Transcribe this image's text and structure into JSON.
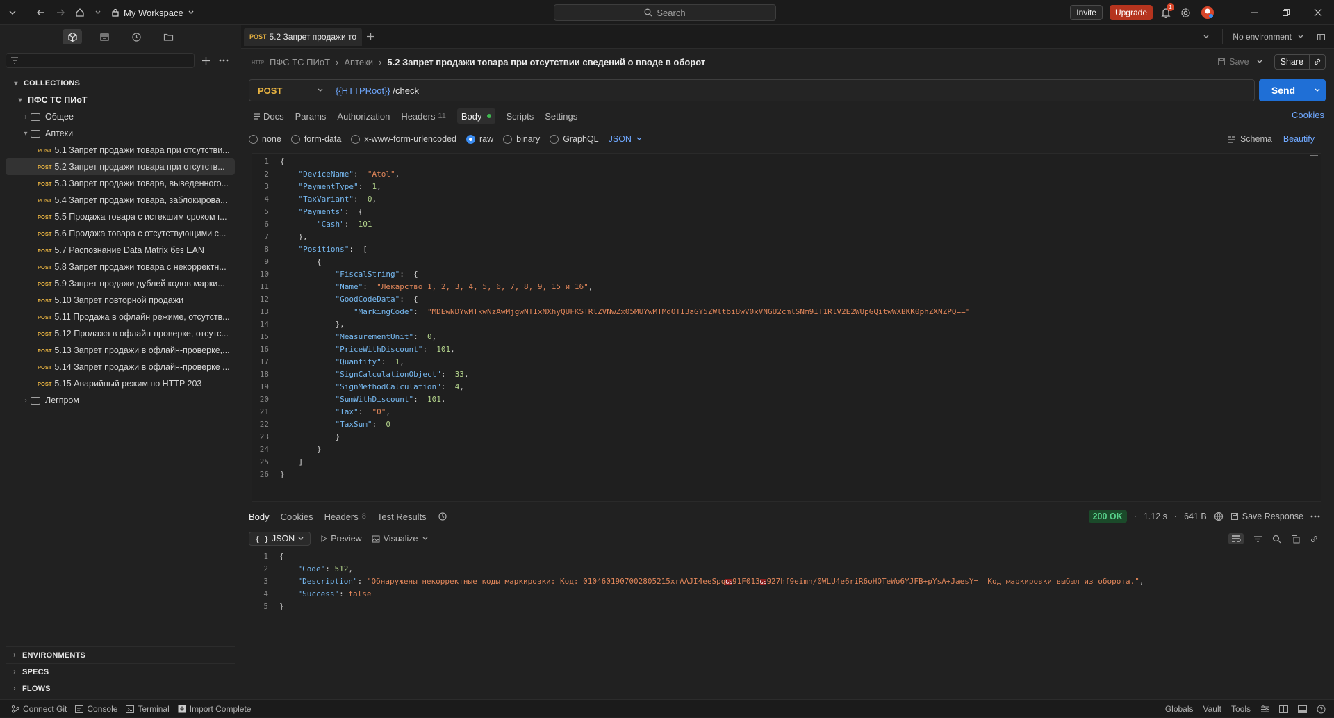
{
  "window": {
    "workspace": "My Workspace",
    "search_placeholder": "Search",
    "invite": "Invite",
    "upgrade": "Upgrade",
    "notification_count": "1"
  },
  "sidebar": {
    "sections": {
      "collections": "COLLECTIONS",
      "environments": "ENVIRONMENTS",
      "specs": "SPECS",
      "flows": "FLOWS"
    },
    "collection_name": "ПФС ТС ПИоТ",
    "folders": {
      "general": "Общее",
      "pharmacies": "Аптеки",
      "light_industry": "Легпром"
    },
    "method_tag": "POST",
    "requests": [
      "5.1 Запрет продажи товара при отсутстви...",
      "5.2 Запрет продажи товара при отсутств...",
      "5.3 Запрет продажи товара, выведенного...",
      "5.4 Запрет продажи товара, заблокирова...",
      "5.5 Продажа товара с истекшим сроком г...",
      "5.6 Продажа товара с отсутствующими с...",
      "5.7 Распознание Data Matrix без EAN",
      "5.8 Запрет продажи товара с некорректн...",
      "5.9 Запрет продажи дублей кодов марки...",
      "5.10 Запрет повторной продажи",
      "5.11 Продажа в офлайн режиме, отсутств...",
      "5.12 Продажа в офлайн-проверке, отсутс...",
      "5.13 Запрет продажи в офлайн-проверке,...",
      "5.14 Запрет продажи в офлайн-проверке ...",
      "5.15 Аварийный режим по HTTP 203"
    ]
  },
  "tab": {
    "method": "POST",
    "title": "5.2 Запрет продажи то"
  },
  "environment": "No environment",
  "breadcrumb": {
    "collection": "ПФС ТС ПИоТ",
    "folder": "Аптеки",
    "current": "5.2 Запрет продажи товара при отсутствии сведений о вводе в оборот"
  },
  "actions": {
    "save": "Save",
    "share": "Share"
  },
  "request": {
    "method": "POST",
    "url_var": "{{HTTPRoot}}",
    "url_path": " /check",
    "send": "Send"
  },
  "request_tabs": {
    "docs": "Docs",
    "params": "Params",
    "authorization": "Authorization",
    "headers": "Headers",
    "headers_count": "11",
    "body": "Body",
    "scripts": "Scripts",
    "settings": "Settings",
    "cookies": "Cookies"
  },
  "body_types": {
    "none": "none",
    "form_data": "form-data",
    "urlencoded": "x-www-form-urlencoded",
    "raw": "raw",
    "binary": "binary",
    "graphql": "GraphQL",
    "format": "JSON",
    "schema": "Schema",
    "beautify": "Beautify"
  },
  "request_body": {
    "DeviceName": "\"Atol\"",
    "PaymentType": "1",
    "TaxVariant": "0",
    "Cash": "101",
    "FiscalString": "",
    "Name": "\"Лекарство 1, 2, 3, 4, 5, 6, 7, 8, 9, 15 и 16\"",
    "MarkingCode": "\"MDEwNDYwMTkwNzAwMjgwNTIxNXhyQUFKSTRlZVNwZx05MUYwMTMdOTI3aGY5ZWltbi8wV0xVNGU2cmlSNm9IT1RlV2E2WUpGQitwWXBKK0phZXNZPQ==\"",
    "MeasurementUnit": "0",
    "PriceWithDiscount": "101",
    "Quantity": "1",
    "SignCalculationObject": "33",
    "SignMethodCalculation": "4",
    "SumWithDiscount": "101",
    "Tax": "\"0\"",
    "TaxSum": "0"
  },
  "response_tabs": {
    "body": "Body",
    "cookies": "Cookies",
    "headers": "Headers",
    "headers_count": "8",
    "test_results": "Test Results"
  },
  "response_meta": {
    "status": "200 OK",
    "time": "1.12 s",
    "size": "641 B",
    "save_response": "Save Response"
  },
  "response_tools": {
    "format": "JSON",
    "preview": "Preview",
    "visualize": "Visualize"
  },
  "response_body": {
    "code": "512",
    "description_prefix": "\"Обнаружены некорректные коды маркировки: Код: 0104601907002805215xrAAJI4eeSpg",
    "gs": "GS",
    "description_mid": "91F013",
    "description_link": "927hf9eimn/0WLU4e6riR6oHOTeWo6YJFB+pYsA+JaesY=",
    "description_suffix": "  Код маркировки выбыл из оборота.\"",
    "success": "false"
  },
  "statusbar": {
    "connect_git": "Connect Git",
    "console": "Console",
    "terminal": "Terminal",
    "import": "Import Complete",
    "globals": "Globals",
    "vault": "Vault",
    "tools": "Tools"
  },
  "colors": {
    "accent": "#1f6fd6",
    "post": "#e8b341",
    "upgrade": "#b5341e",
    "json_key": "#76b8f0",
    "json_string": "#e0865a",
    "json_number": "#b4d48c"
  }
}
